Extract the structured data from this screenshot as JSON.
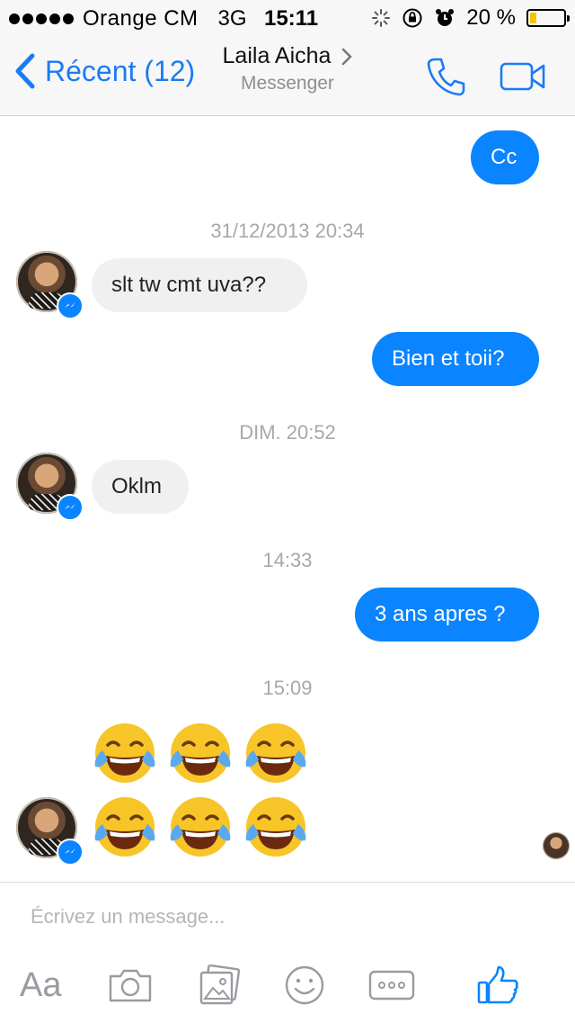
{
  "status_bar": {
    "carrier": "Orange CM",
    "network": "3G",
    "time": "15:11",
    "battery": "20 %",
    "battery_level": 0.2
  },
  "nav": {
    "back_label": "Récent (12)",
    "contact_name": "Laila Aicha",
    "subtitle": "Messenger"
  },
  "messages": {
    "m1": "Cc",
    "ts1": "31/12/2013 20:34",
    "m2": "slt tw cmt uva??",
    "m3": "Bien et toii?",
    "ts2": "DIM. 20:52",
    "m4": "Oklm",
    "ts3": "14:33",
    "m5": "3 ans apres ?",
    "ts4": "15:09"
  },
  "composer": {
    "placeholder": "Écrivez un message...",
    "text_label": "Aa"
  },
  "colors": {
    "accent": "#0a84ff",
    "incoming_bubble": "#f0f0f0",
    "timestamp": "#a8a8ac"
  },
  "icons": [
    "back-chevron-icon",
    "phone-icon",
    "video-icon",
    "messenger-icon",
    "camera-icon",
    "photo-icon",
    "emoji-icon",
    "more-icon",
    "like-icon"
  ]
}
